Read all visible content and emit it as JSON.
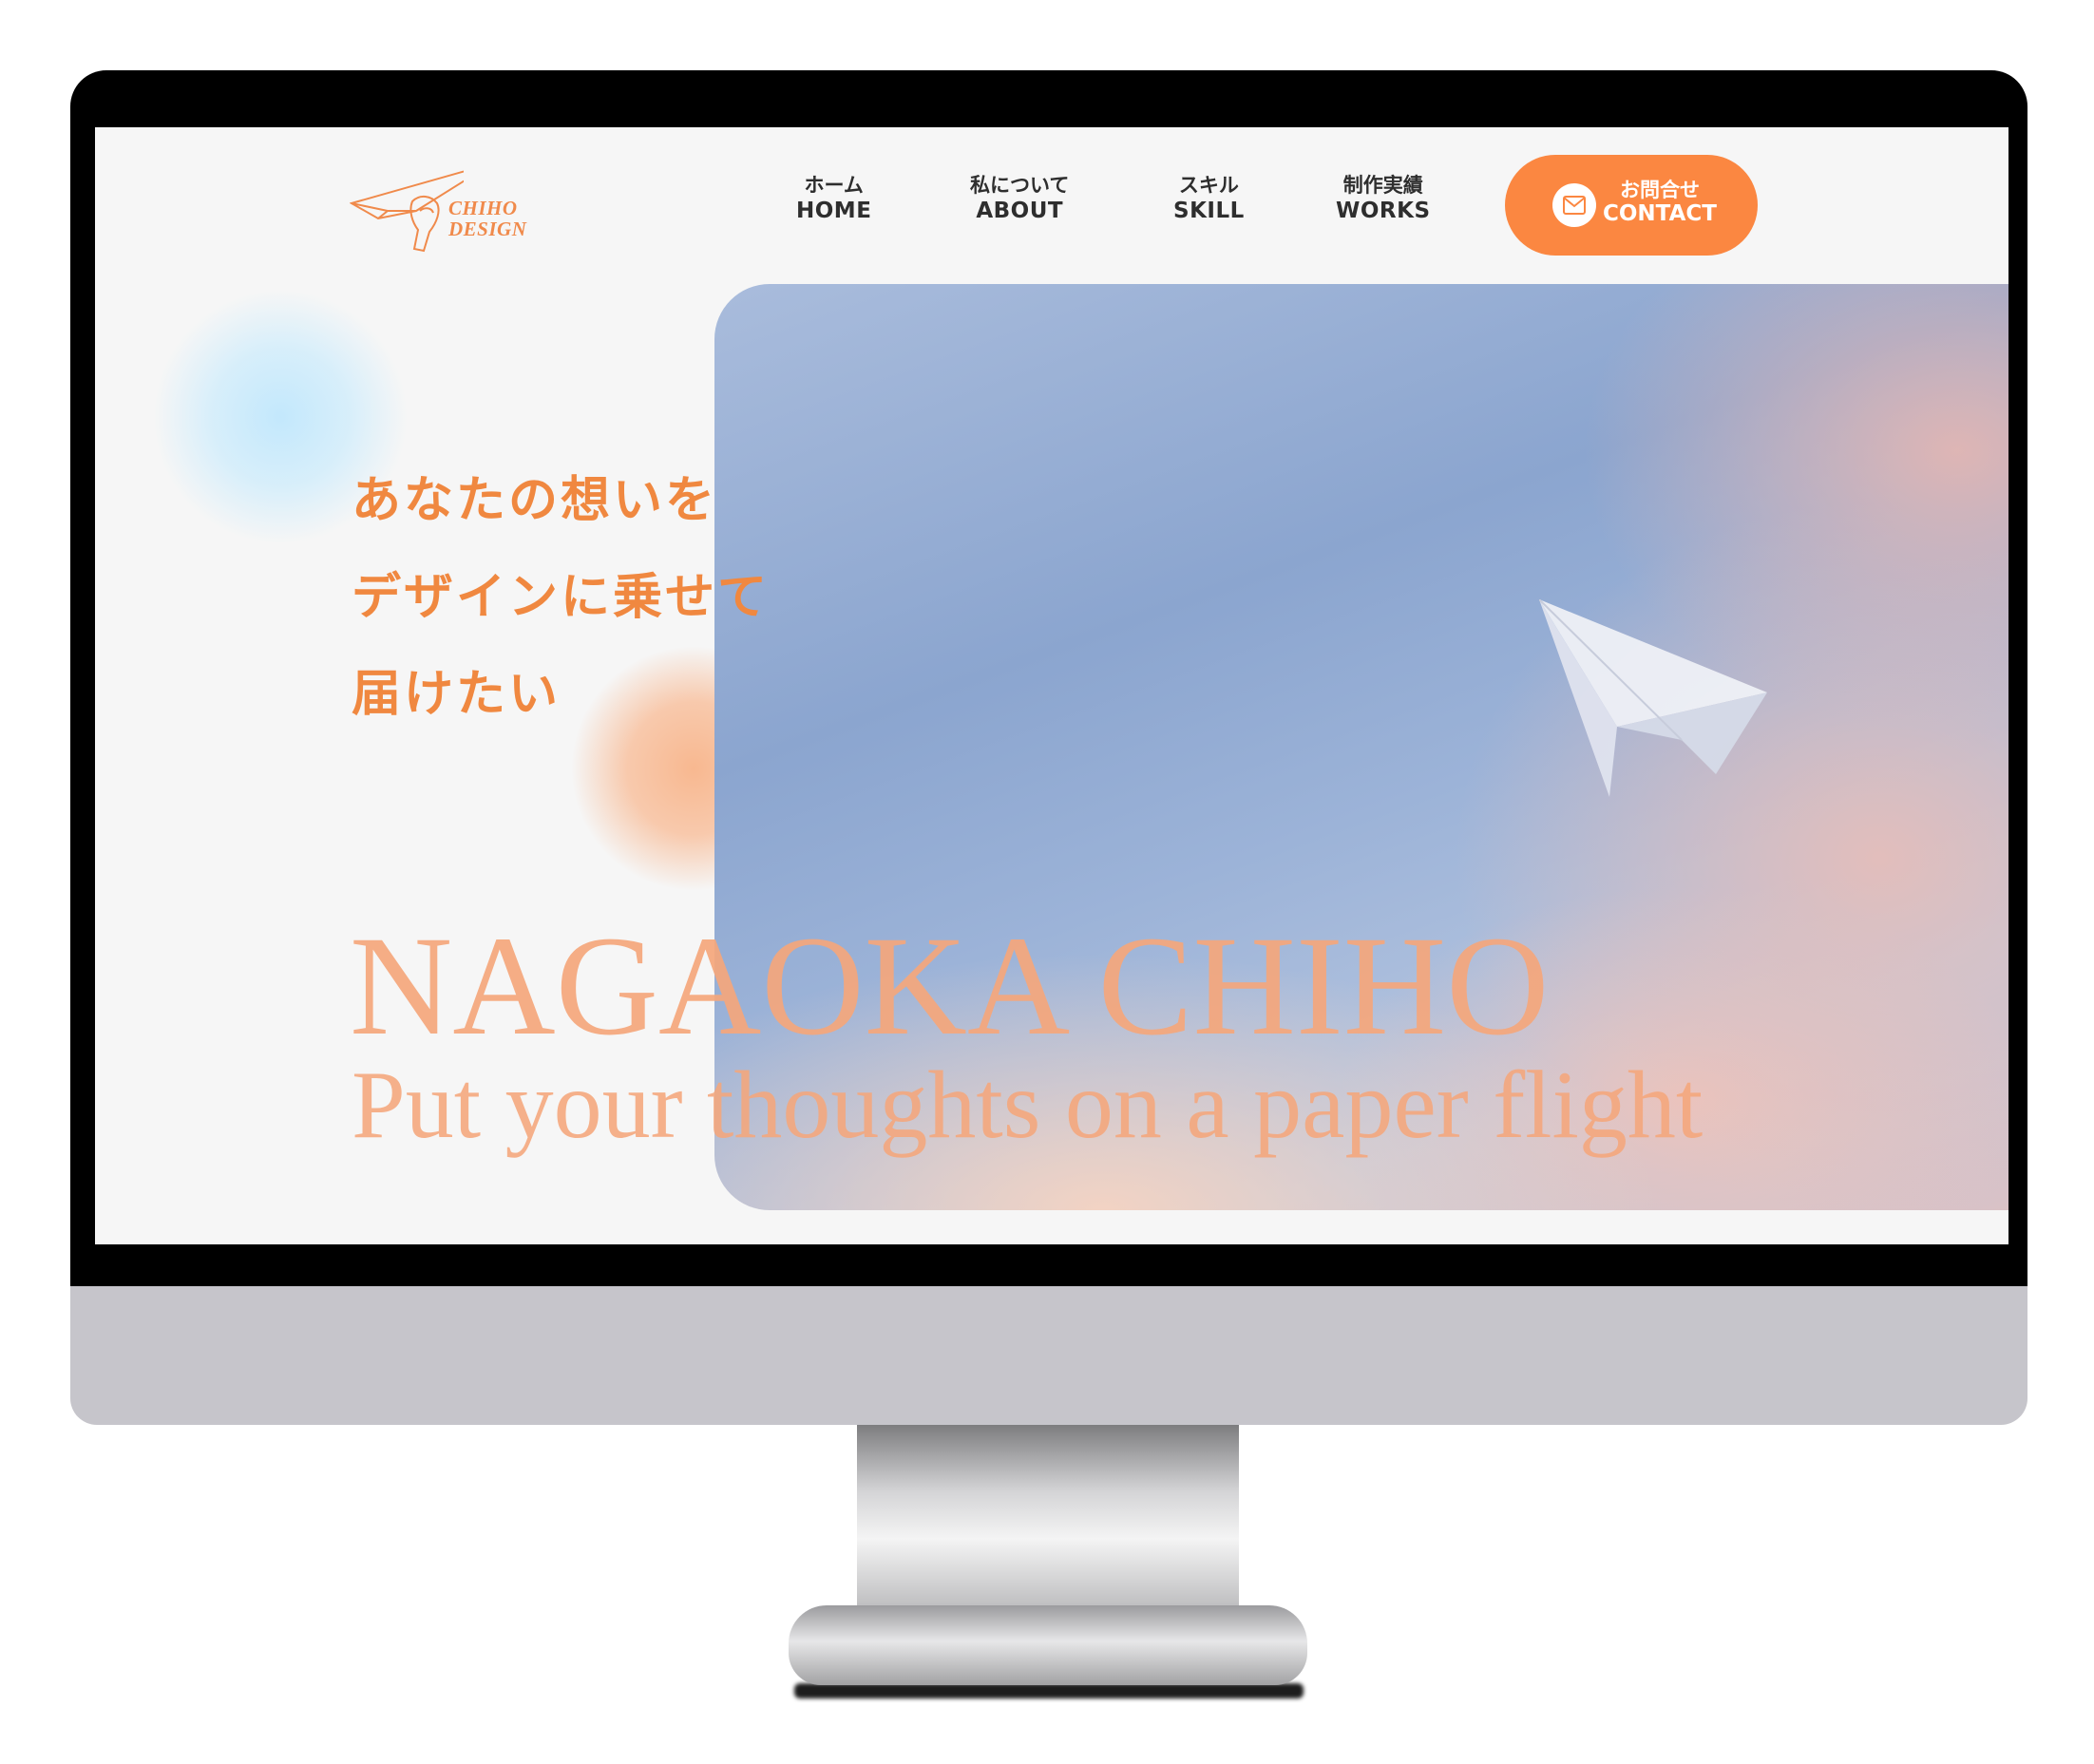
{
  "header": {
    "logo": {
      "line1": "CHIHO",
      "line2": "DESIGN",
      "icon": "paper-plane-hand-icon"
    },
    "nav": [
      {
        "jp": "ホーム",
        "en": "HOME"
      },
      {
        "jp": "私について",
        "en": "ABOUT"
      },
      {
        "jp": "スキル",
        "en": "SKILL"
      },
      {
        "jp": "制作実績",
        "en": "WORKS"
      }
    ],
    "contact": {
      "jp": "お問合せ",
      "en": "CONTACT",
      "icon": "mail-icon"
    }
  },
  "hero": {
    "tagline": [
      "あなたの想いを",
      "デザインに乗せて",
      "届けたい"
    ],
    "name": "NAGAOKA CHIHO",
    "subtitle": "Put your thoughts on a paper flight",
    "image_icon": "paper-plane-icon"
  },
  "colors": {
    "accent": "#fb8741",
    "tagline": "#f08840",
    "hero_text": "#f5a77c",
    "nav_text": "#2e2e2e",
    "screen_bg": "#f6f6f6",
    "bezel": "#000000",
    "chin": "#c6c5cb"
  }
}
